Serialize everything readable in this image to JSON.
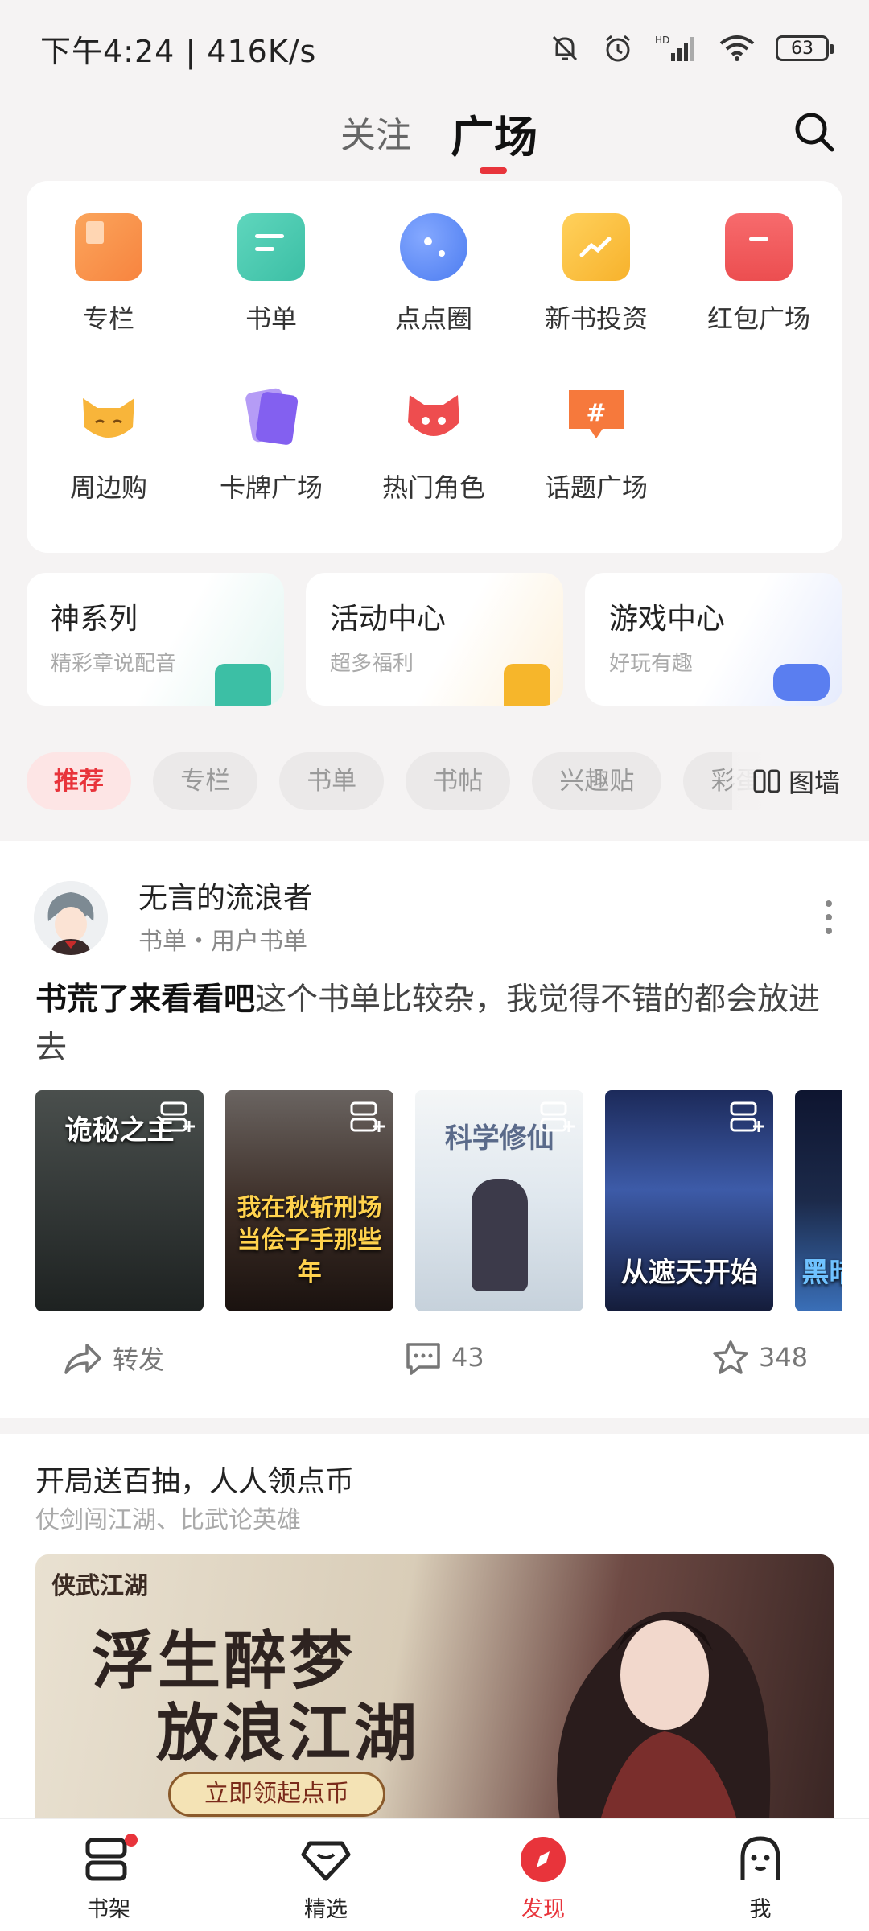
{
  "status_bar": {
    "time": "下午4:24 | 416K/s",
    "battery": "63",
    "network": "HD"
  },
  "header": {
    "tabs": [
      {
        "label": "关注"
      },
      {
        "label": "广场"
      }
    ]
  },
  "grid": {
    "items": [
      {
        "label": "专栏",
        "icon": "column-icon",
        "color": "#f7843f"
      },
      {
        "label": "书单",
        "icon": "booklist-icon",
        "color": "#3cbfa5"
      },
      {
        "label": "点点圈",
        "icon": "planet-icon",
        "color": "#4c7cf0"
      },
      {
        "label": "新书投资",
        "icon": "invest-icon",
        "color": "#f7b22c"
      },
      {
        "label": "红包广场",
        "icon": "redpacket-icon",
        "color": "#ec4e50"
      },
      {
        "label": "周边购",
        "icon": "fox-icon",
        "color": "#f8b53a"
      },
      {
        "label": "卡牌广场",
        "icon": "cards-icon",
        "color": "#8360f0"
      },
      {
        "label": "热门角色",
        "icon": "character-icon",
        "color": "#ee4d4f"
      },
      {
        "label": "话题广场",
        "icon": "topic-icon",
        "color": "#f6793c"
      }
    ]
  },
  "features": [
    {
      "title": "神系列",
      "subtitle": "精彩章说配音",
      "color": "#3cbfa5"
    },
    {
      "title": "活动中心",
      "subtitle": "超多福利",
      "color": "#f6b62b"
    },
    {
      "title": "游戏中心",
      "subtitle": "好玩有趣",
      "color": "#5a7ef0"
    }
  ],
  "chips": [
    "推荐",
    "专栏",
    "书单",
    "书帖",
    "兴趣贴",
    "彩蛋"
  ],
  "wall_label": "图墙",
  "post": {
    "user": "无言的流浪者",
    "meta": "书单・用户书单",
    "title": "书荒了来看看吧",
    "body": "这个书单比较杂，我觉得不错的都会放进去",
    "covers": [
      {
        "title": "诡秘之主",
        "bg": "#2f3433"
      },
      {
        "title": "我在秋斩刑场当侩子手那些年",
        "bg": "#3a2b24"
      },
      {
        "title": "科学修仙",
        "bg": "#dfe7ee"
      },
      {
        "title": "从遮天开始",
        "bg": "#25336a"
      },
      {
        "title": "黑暗",
        "bg": "#1c2a4a"
      }
    ],
    "share_label": "转发",
    "comments": "43",
    "stars": "348"
  },
  "promo": {
    "title": "开局送百抽，人人领点币",
    "subtitle": "仗剑闯江湖、比武论英雄",
    "logo": "侠武江湖",
    "line1": "浮生醉梦",
    "line2": "放浪江湖",
    "cta": "立即领起点币"
  },
  "bottom_nav": [
    {
      "label": "书架"
    },
    {
      "label": "精选"
    },
    {
      "label": "发现"
    },
    {
      "label": "我"
    }
  ],
  "accent": "#e8343b"
}
